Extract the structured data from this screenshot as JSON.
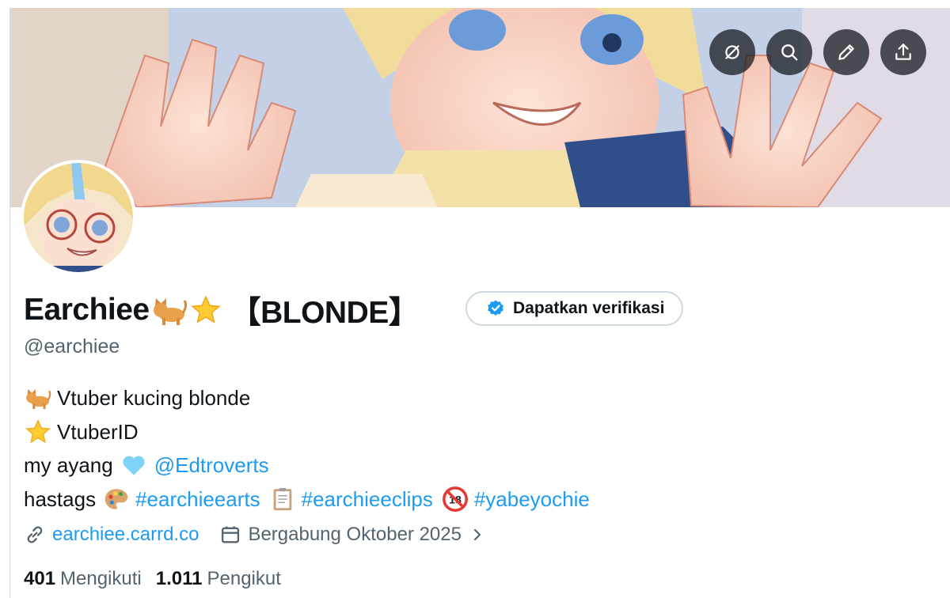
{
  "banner_actions": [
    {
      "name": "unfollow-style-icon",
      "label": ""
    },
    {
      "name": "search-icon",
      "label": ""
    },
    {
      "name": "edit-icon",
      "label": ""
    },
    {
      "name": "share-icon",
      "label": ""
    }
  ],
  "profile": {
    "display_name": "Earchiee",
    "name_suffix": "【BLONDE】",
    "handle": "@earchiee",
    "verify_label": "Dapatkan verifikasi"
  },
  "bio": {
    "line1_text": "Vtuber kucing blonde",
    "line2_text": "VtuberID",
    "line3_text": "my ayang",
    "line3_mention": "@Edtroverts",
    "line4_text": "hastags",
    "hashtag1": "#earchieearts",
    "hashtag2": "#earchieeclips",
    "hashtag3": "#yabeyochie"
  },
  "meta": {
    "website": "earchiee.carrd.co",
    "joined": "Bergabung Oktober 2025"
  },
  "stats": {
    "following_count": "401",
    "following_label": "Mengikuti",
    "followers_count": "1.011",
    "followers_label": "Pengikut"
  },
  "colors": {
    "accent": "#1d9bf0",
    "muted": "#536471",
    "text": "#0f1419"
  }
}
